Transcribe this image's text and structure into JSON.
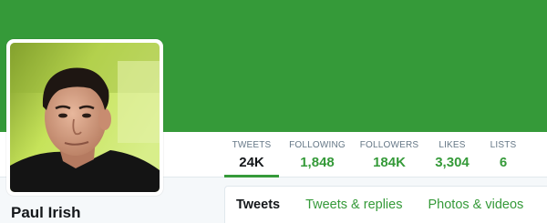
{
  "colors": {
    "accent": "#359a39",
    "banner": "#359a39",
    "background": "#f5f8fa"
  },
  "profile": {
    "name": "Paul Irish"
  },
  "stats": [
    {
      "label": "TWEETS",
      "value": "24K"
    },
    {
      "label": "FOLLOWING",
      "value": "1,848"
    },
    {
      "label": "FOLLOWERS",
      "value": "184K"
    },
    {
      "label": "LIKES",
      "value": "3,304"
    },
    {
      "label": "LISTS",
      "value": "6"
    }
  ],
  "tabs": [
    {
      "label": "Tweets"
    },
    {
      "label": "Tweets & replies"
    },
    {
      "label": "Photos & videos"
    }
  ]
}
